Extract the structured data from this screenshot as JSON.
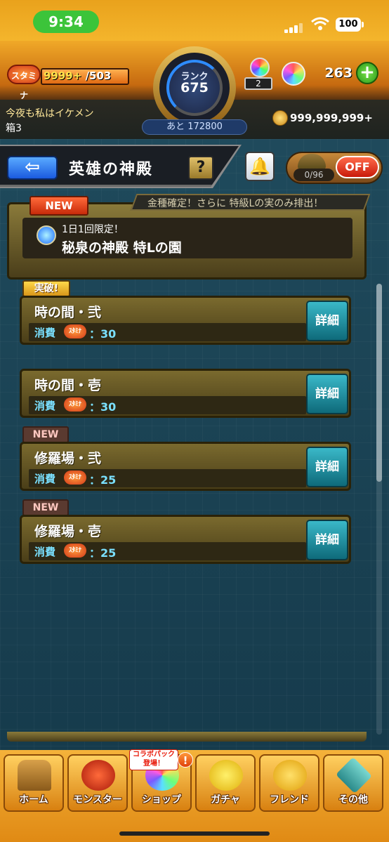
{
  "status_bar": {
    "time": "9:34",
    "battery": "100"
  },
  "header": {
    "stamina_label": "スタミナ",
    "stamina_current": "9999+",
    "stamina_max": "/503",
    "stamina_fill": 1.0,
    "rank_label": "ランク",
    "rank_value": "675",
    "rank_next": "あと 172800",
    "orb_stock": "2",
    "orb_count": "263",
    "add_label": "+",
    "message_line1": "今夜も私はイケメン",
    "message_line2": "箱3",
    "coins": "999,999,999+"
  },
  "titlebar": {
    "back": "⇦",
    "title": "英雄の神殿",
    "help": "?",
    "bell": "🔔",
    "toggle_count": "0/96",
    "toggle_label": "OFF"
  },
  "event": {
    "strip_text": "金種確定！さらに 特級Lの実のみ排出！",
    "new_label": "NEW",
    "subtitle": "1日1回限定！",
    "title": "秘泉の神殿 特Lの園"
  },
  "quests": [
    {
      "badge": "実破!",
      "name": "時の間・弐",
      "cost_label": "消費",
      "cost_icon": "ｽﾀﾐﾅ",
      "cost": "：30",
      "detail": "詳細"
    },
    {
      "badge": "",
      "name": "時の間・壱",
      "cost_label": "消費",
      "cost_icon": "ｽﾀﾐﾅ",
      "cost": "：30",
      "detail": "詳細"
    },
    {
      "badge": "NEW",
      "name": "修羅場・弐",
      "cost_label": "消費",
      "cost_icon": "ｽﾀﾐﾅ",
      "cost": "：25",
      "detail": "詳細"
    },
    {
      "badge": "NEW",
      "name": "修羅場・壱",
      "cost_label": "消費",
      "cost_icon": "ｽﾀﾐﾅ",
      "cost": "：25",
      "detail": "詳細"
    }
  ],
  "nav": {
    "collab": "コラボパック登場！",
    "alert": "!",
    "items": [
      {
        "label": "ホーム"
      },
      {
        "label": "モンスター"
      },
      {
        "label": "ショップ"
      },
      {
        "label": "ガチャ"
      },
      {
        "label": "フレンド"
      },
      {
        "label": "その他"
      }
    ]
  }
}
